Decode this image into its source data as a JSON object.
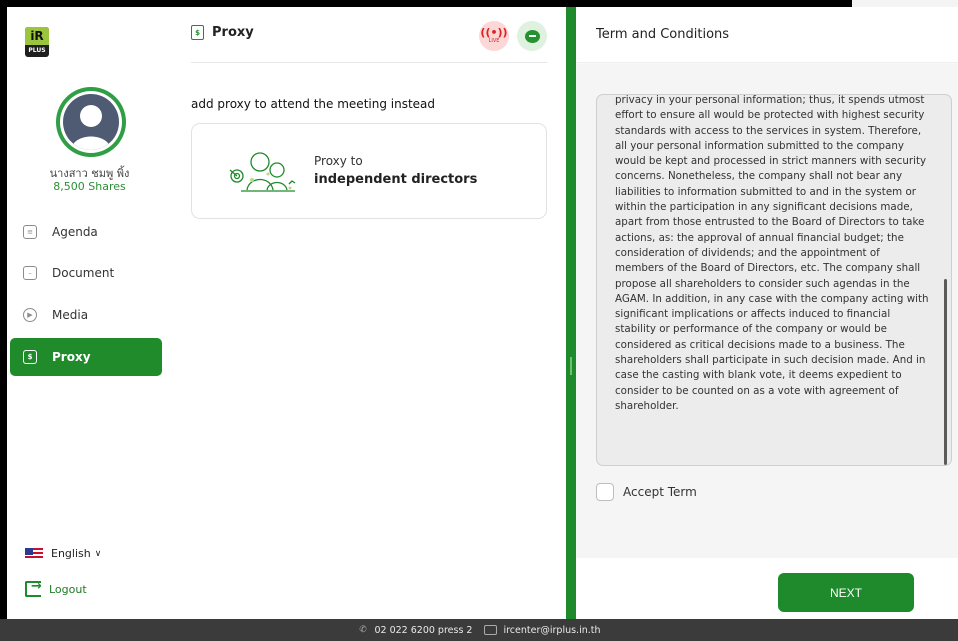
{
  "sidebar": {
    "logo_top": "iR",
    "logo_bottom": "PLUS",
    "user_name": "นางสาว ชมพู พิ้ง",
    "user_shares": "8,500 Shares",
    "nav": [
      {
        "label": "Agenda",
        "icon": "agenda-icon"
      },
      {
        "label": "Document",
        "icon": "document-icon"
      },
      {
        "label": "Media",
        "icon": "play-icon"
      },
      {
        "label": "Proxy",
        "icon": "proxy-icon",
        "active": true
      }
    ],
    "language": "English",
    "logout": "Logout"
  },
  "middle": {
    "title": "Proxy",
    "live_label": "LIVE",
    "subtitle": "add proxy to attend the meeting instead",
    "card": {
      "line1": "Proxy to",
      "line2": "independent directors"
    }
  },
  "terms": {
    "title": "Term and Conditions",
    "body": "privacy in your personal information; thus, it spends utmost effort to ensure all would be protected with highest security standards with access to the services in system. Therefore, all your personal information submitted to the company would be kept and processed in strict manners with security concerns. Nonetheless, the company shall not bear any liabilities to information submitted to and in the system or within the participation in any significant decisions made, apart from those entrusted to the Board of Directors to take actions, as: the approval of annual financial budget; the consideration of dividends; and the appointment of members of the Board of Directors, etc. The company shall propose all shareholders to consider such agendas in the AGAM. In addition, in any case with the company acting with significant implications or affects induced to financial stability or performance of the company or would be considered as critical decisions made to a business. The shareholders shall participate in such decision made. And in case the casting with blank vote, it deems expedient to consider to be counted on as a vote with agreement of shareholder.",
    "accept_label": "Accept Term",
    "next_label": "NEXT"
  },
  "footer": {
    "phone": "02 022 6200 press 2",
    "email": "ircenter@irplus.in.th"
  },
  "colors": {
    "brand_green": "#1f8a2b",
    "live_red": "#e02020"
  }
}
